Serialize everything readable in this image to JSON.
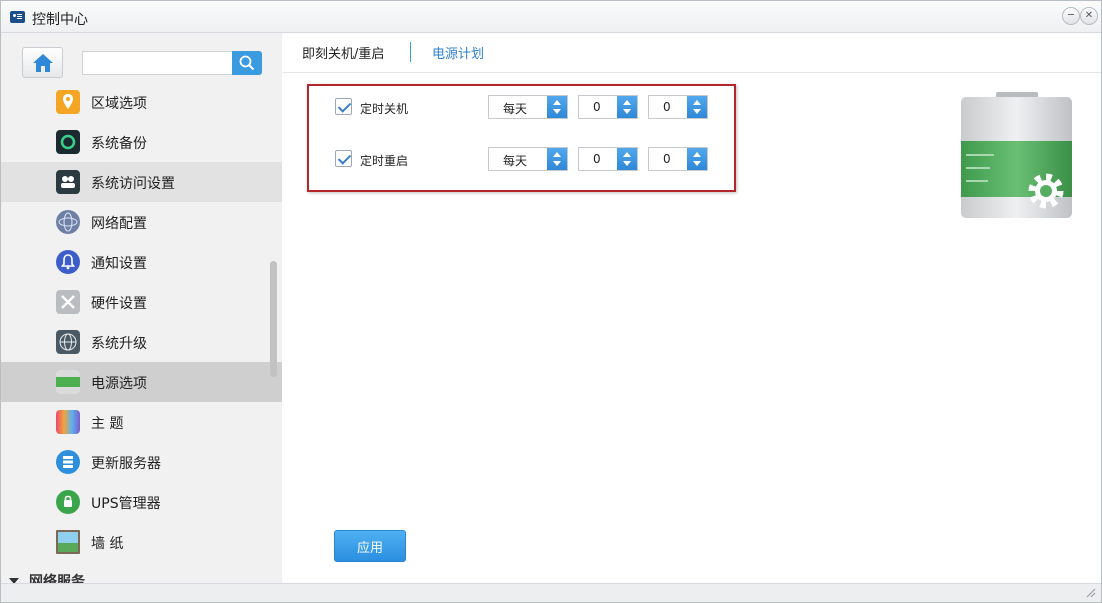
{
  "window": {
    "title": "控制中心",
    "minimize_symbol": "─",
    "close_symbol": "✕"
  },
  "search": {
    "value": "",
    "placeholder": ""
  },
  "sidebar": {
    "items": [
      {
        "label": "区域选项",
        "icon": "location-icon"
      },
      {
        "label": "系统备份",
        "icon": "backup-icon"
      },
      {
        "label": "系统访问设置",
        "icon": "user-access-icon"
      },
      {
        "label": "网络配置",
        "icon": "network-globe-icon"
      },
      {
        "label": "通知设置",
        "icon": "bell-icon"
      },
      {
        "label": "硬件设置",
        "icon": "tools-icon"
      },
      {
        "label": "系统升级",
        "icon": "upgrade-globe-icon"
      },
      {
        "label": "电源选项",
        "icon": "battery-icon"
      },
      {
        "label": "主 题",
        "icon": "theme-icon"
      },
      {
        "label": "更新服务器",
        "icon": "update-server-icon"
      },
      {
        "label": "UPS管理器",
        "icon": "ups-icon"
      },
      {
        "label": "墙 纸",
        "icon": "wallpaper-icon"
      }
    ],
    "group_header": "网络服务"
  },
  "tabs": [
    {
      "label": "即刻关机/重启"
    },
    {
      "label": "电源计划"
    }
  ],
  "schedule": {
    "rows": [
      {
        "label": "定时关机",
        "checked": true,
        "frequency": "每天",
        "hour": "0",
        "minute": "0"
      },
      {
        "label": "定时重启",
        "checked": true,
        "frequency": "每天",
        "hour": "0",
        "minute": "0"
      }
    ]
  },
  "apply_label": "应用",
  "colors": {
    "accent": "#3a9be0",
    "highlight_border": "#b3272b",
    "active_item": "#cfcfcf"
  }
}
